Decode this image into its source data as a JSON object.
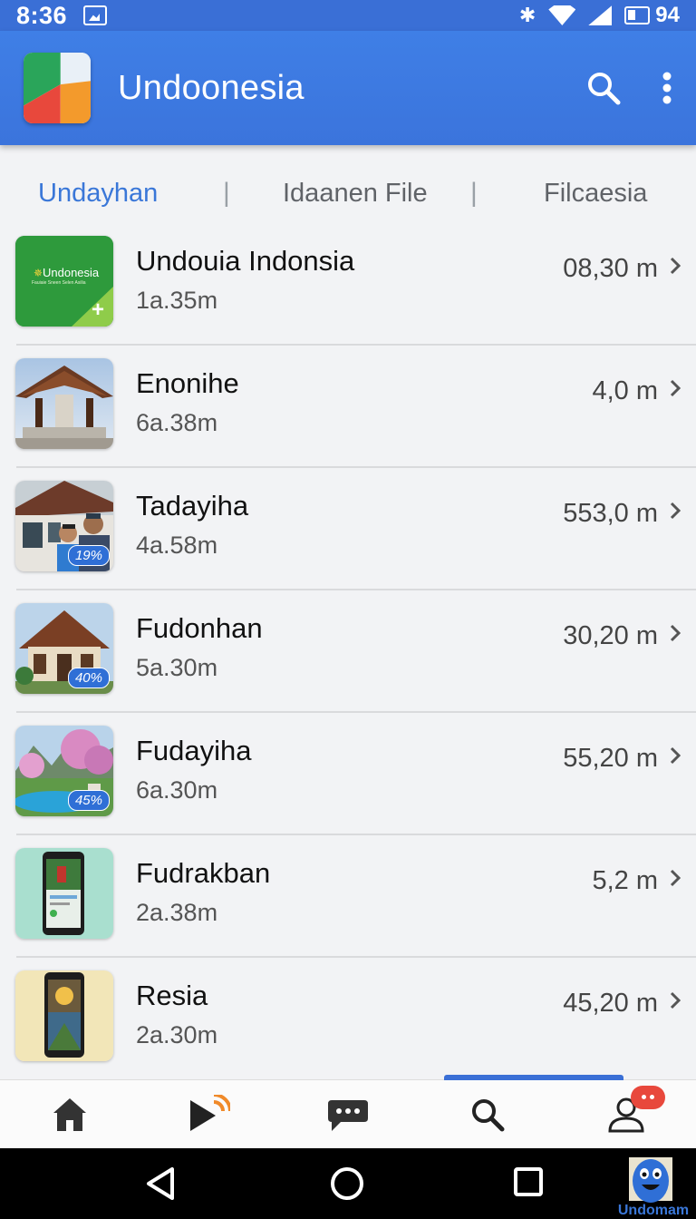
{
  "status_bar": {
    "time": "8:36",
    "battery": "94"
  },
  "app_bar": {
    "title": "Undoonesia"
  },
  "tabs": [
    {
      "label": "Undayhan",
      "active": true
    },
    {
      "label": "Idaanen File",
      "active": false
    },
    {
      "label": "Filcaesia",
      "active": false
    }
  ],
  "items": [
    {
      "name": "Undouia Indonsia",
      "sub": "1a.35m",
      "distance": "08,30 m",
      "thumb": "undonesia-logo",
      "logo_text": "Undonesia",
      "logo_small": "Fauiaie Sneen Selen Asilia"
    },
    {
      "name": "Enonihe",
      "sub": "6a.38m",
      "distance": "4,0 m",
      "thumb": "temple-roof"
    },
    {
      "name": "Tadayiha",
      "sub": "4a.58m",
      "distance": "553,0 m",
      "thumb": "people-house",
      "badge": "19%"
    },
    {
      "name": "Fudonhan",
      "sub": "5a.30m",
      "distance": "30,20 m",
      "thumb": "traditional-house",
      "badge": "40%"
    },
    {
      "name": "Fudayiha",
      "sub": "6a.30m",
      "distance": "55,20 m",
      "thumb": "garden-pool",
      "badge": "45%"
    },
    {
      "name": "Fudrakban",
      "sub": "2a.38m",
      "distance": "5,2 m",
      "thumb": "phone-green"
    },
    {
      "name": "Resia",
      "sub": "2a.30m",
      "distance": "45,20 m",
      "thumb": "phone-yellow"
    }
  ],
  "bottom_nav": [
    "home-icon",
    "play-cast-icon",
    "chat-icon",
    "search-icon",
    "profile-icon"
  ],
  "mascot_label": "Undomam",
  "colors": {
    "accent": "#3a77d8",
    "app_bar": "#3b74dc",
    "badge": "#2f6fd6",
    "notification": "#e8483c"
  }
}
